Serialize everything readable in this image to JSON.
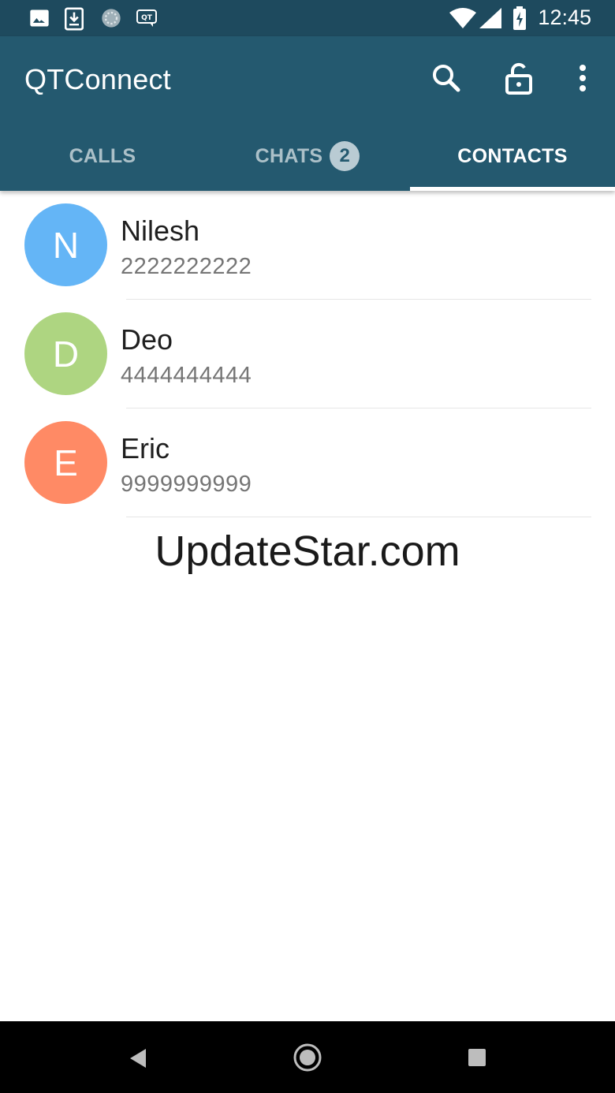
{
  "status_bar": {
    "time": "12:45",
    "left_icons": [
      "image-icon",
      "download-icon",
      "sync-icon",
      "qt-icon"
    ],
    "qt_icon_label": "QT",
    "right_icons": [
      "wifi-icon",
      "signal-icon",
      "battery-charging-icon"
    ]
  },
  "app_bar": {
    "title": "QTConnect",
    "actions": [
      "search-icon",
      "lock-open-icon",
      "more-vert-icon"
    ],
    "background": "#24596f"
  },
  "tabs": [
    {
      "label": "CALLS",
      "active": false
    },
    {
      "label": "CHATS",
      "active": false,
      "badge": "2"
    },
    {
      "label": "CONTACTS",
      "active": true
    }
  ],
  "contacts": [
    {
      "initial": "N",
      "name": "Nilesh",
      "phone": "2222222222",
      "color": "#64b5f6"
    },
    {
      "initial": "D",
      "name": "Deo",
      "phone": "4444444444",
      "color": "#aed581"
    },
    {
      "initial": "E",
      "name": "Eric",
      "phone": "9999999999",
      "color": "#ff8a65"
    }
  ],
  "watermark": "UpdateStar.com",
  "nav_bar": {
    "buttons": [
      "back-icon",
      "home-icon",
      "recents-icon"
    ]
  }
}
